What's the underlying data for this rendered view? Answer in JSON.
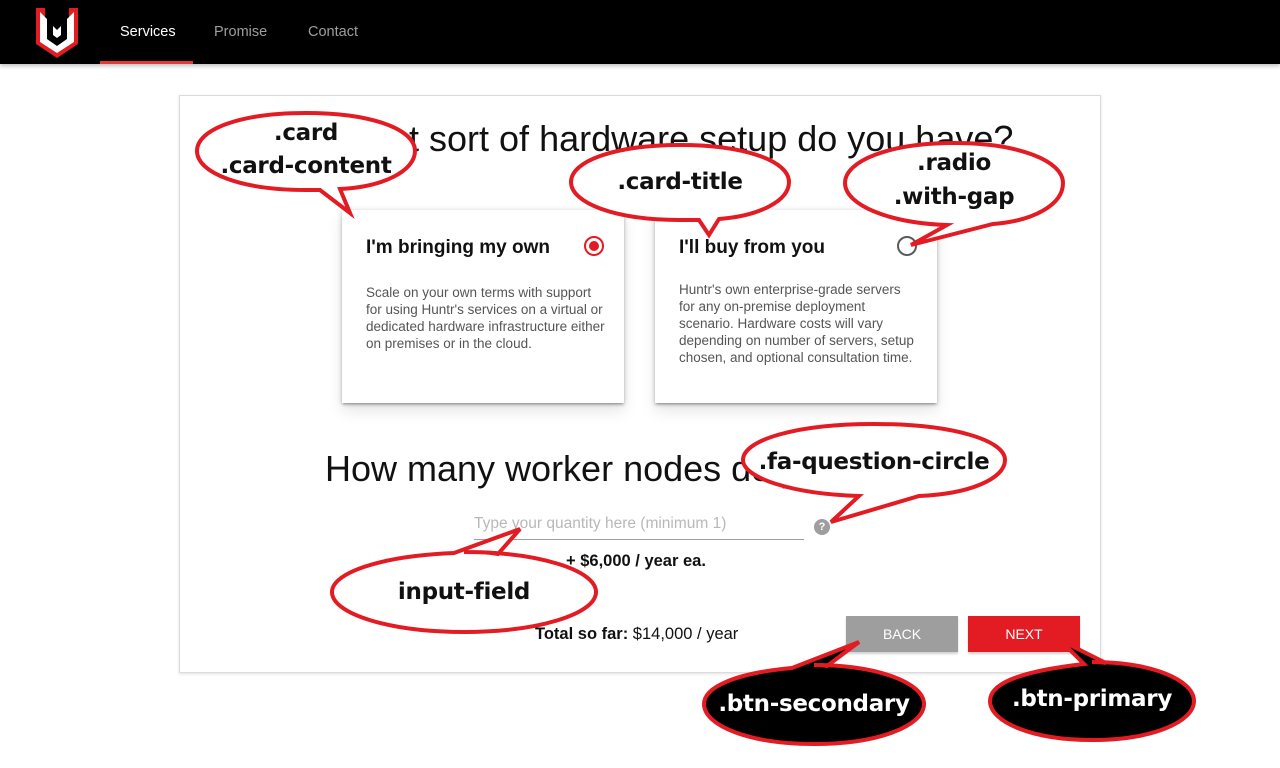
{
  "nav": {
    "links": [
      {
        "label": "Services",
        "active": true
      },
      {
        "label": "Promise",
        "active": false
      },
      {
        "label": "Contact",
        "active": false
      }
    ]
  },
  "heading_hardware": "What sort of hardware setup do you have?",
  "options": [
    {
      "title": "I'm bringing my own",
      "description": "Scale on your own terms with support for using Huntr's services on a virtual or dedicated hardware infrastructure either on premises or in the cloud.",
      "selected": true
    },
    {
      "title": "I'll buy from you",
      "description": "Huntr's own enterprise-grade servers for any on-premise deployment scenario. Hardware costs will vary depending on number of servers, setup chosen, and optional consultation time.",
      "selected": false
    }
  ],
  "heading_nodes": "How many worker nodes do you need?",
  "quantity": {
    "value": "",
    "placeholder": "Type your quantity here (minimum 1)"
  },
  "help_icon": "question-circle-icon",
  "price_each": "+ $6,000 / year ea.",
  "total": {
    "label": "Total so far:",
    "value": "$14,000 / year"
  },
  "buttons": {
    "back": "BACK",
    "next": "NEXT"
  },
  "annotations": {
    "card": ".card",
    "card_content": ".card-content",
    "card_title": ".card-title",
    "radio": ".radio",
    "with_gap": ".with-gap",
    "fa_question": ".fa-question-circle",
    "input_field": "input-field",
    "btn_secondary": ".btn-secondary",
    "btn_primary": ".btn-primary"
  },
  "colors": {
    "accent": "#e31b23",
    "secondary": "#9e9e9e",
    "navbar": "#000000"
  }
}
